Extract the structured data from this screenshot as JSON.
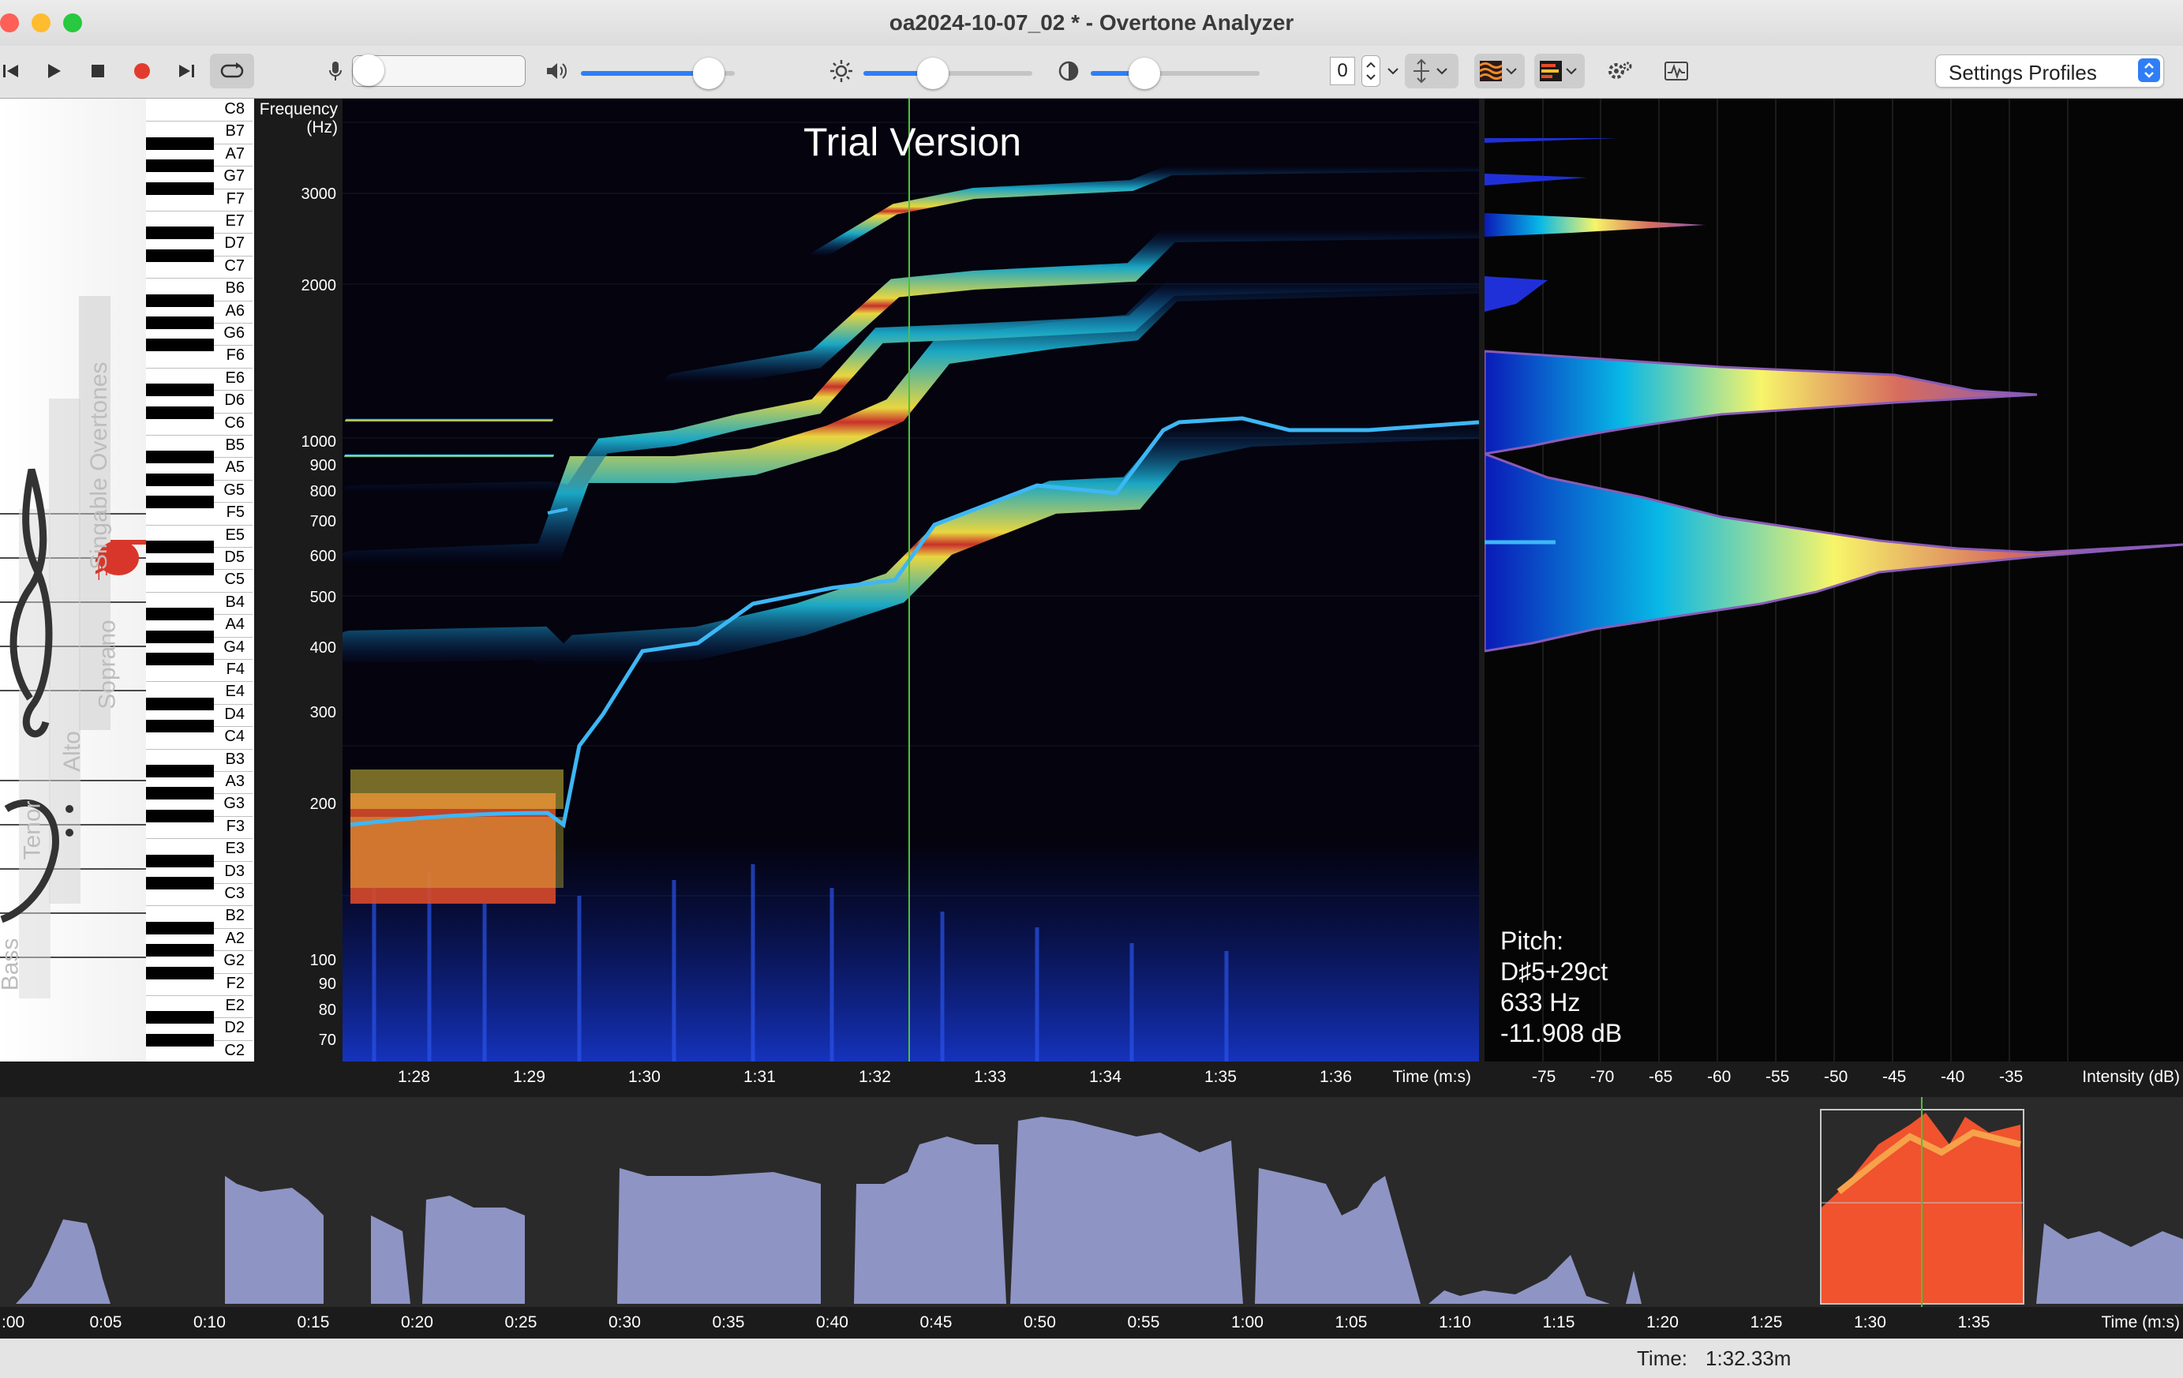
{
  "window": {
    "title": "oa2024-10-07_02 *  - Overtone Analyzer",
    "traffic_lights": {
      "close": "#fe5f57",
      "minimize": "#febc2e",
      "zoom": "#28c840"
    }
  },
  "toolbar": {
    "icons": [
      "skip-back-icon",
      "play-icon",
      "stop-icon",
      "record-icon",
      "skip-forward-icon",
      "loop-icon"
    ],
    "mic_icon": "microphone-icon",
    "speaker_icon": "speaker-icon",
    "brightness_icon": "sun-icon",
    "contrast_icon": "contrast-icon",
    "volume_level": 0.83,
    "brightness_level": 0.41,
    "contrast_level": 0.32,
    "stepper_value": "0",
    "settings_profiles_label": "Settings Profiles",
    "accent": "#2f7ef6"
  },
  "sidebar": {
    "voice_labels": [
      "Bass",
      "Tenor",
      "Alto",
      "Soprano",
      "Singable Overtones"
    ],
    "notes": [
      "C8",
      "B7",
      "A7",
      "G7",
      "F7",
      "E7",
      "D7",
      "C7",
      "B6",
      "A6",
      "G6",
      "F6",
      "E6",
      "D6",
      "C6",
      "B5",
      "A5",
      "G5",
      "F5",
      "E5",
      "D5",
      "C5",
      "B4",
      "A4",
      "G4",
      "F4",
      "E4",
      "D4",
      "C4",
      "B3",
      "A3",
      "G3",
      "F3",
      "E3",
      "D3",
      "C3",
      "B2",
      "A2",
      "G2",
      "F2",
      "E2",
      "D2",
      "C2"
    ],
    "highlight_color": "#d9362b"
  },
  "spectrogram": {
    "axis_title": "Frequency\n(Hz)",
    "freq_labels": [
      "3000",
      "2000",
      "1000",
      "900",
      "800",
      "700",
      "600",
      "500",
      "400",
      "300",
      "200",
      "100",
      "90",
      "80",
      "70"
    ],
    "watermark": "Trial Version",
    "time_labels": [
      "1:28",
      "1:29",
      "1:30",
      "1:31",
      "1:32",
      "1:33",
      "1:34",
      "1:35",
      "1:36"
    ],
    "time_axis_title": "Time (m:s)",
    "cursor_color": "#4ec236"
  },
  "intensity": {
    "labels": [
      "-75",
      "-70",
      "-65",
      "-60",
      "-55",
      "-50",
      "-45",
      "-40",
      "-35"
    ],
    "axis_title": "Intensity (dB)"
  },
  "pitch": {
    "label": "Pitch:",
    "note": "D♯5+29ct",
    "hz": "633 Hz",
    "db": "-11.908 dB"
  },
  "overview": {
    "time_labels": [
      ":00",
      "0:05",
      "0:10",
      "0:15",
      "0:20",
      "0:25",
      "0:30",
      "0:35",
      "0:40",
      "0:45",
      "0:50",
      "0:55",
      "1:00",
      "1:05",
      "1:10",
      "1:15",
      "1:20",
      "1:25",
      "1:30",
      "1:35"
    ],
    "time_axis_title": "Time (m:s)",
    "waveform_color": "#8e94c4",
    "selection_color": "#f0532e"
  },
  "status": {
    "time_label": "Time:",
    "time_value": "1:32.33m"
  }
}
